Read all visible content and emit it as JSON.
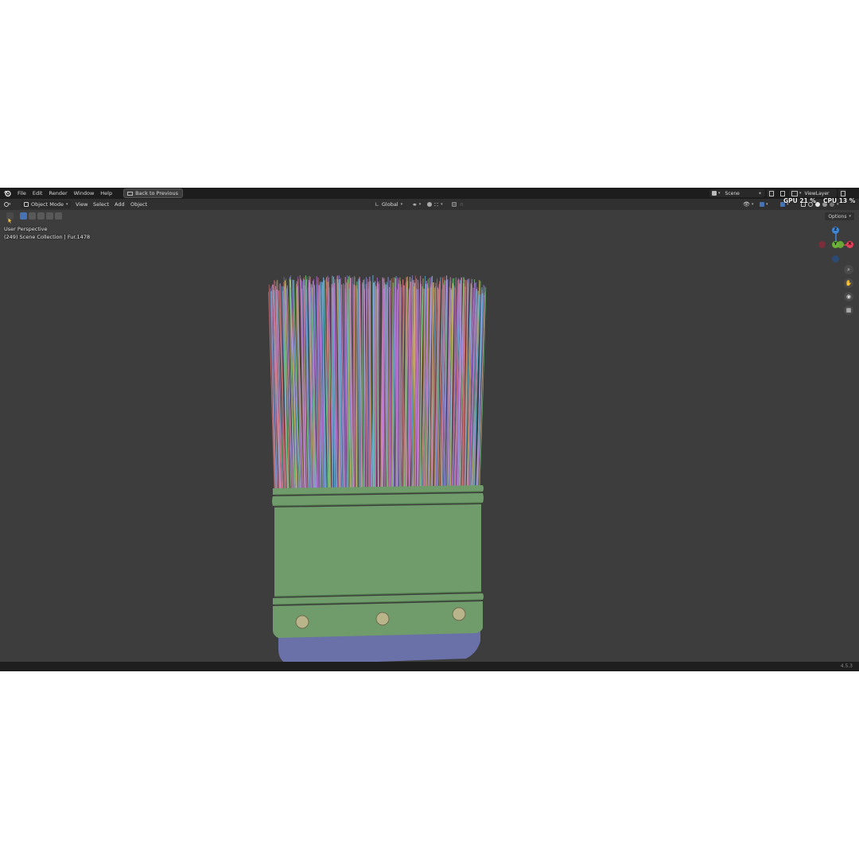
{
  "topbar": {
    "menus": [
      "File",
      "Edit",
      "Render",
      "Window",
      "Help"
    ],
    "back_button": "Back to Previous",
    "scene": "Scene",
    "view_layer": "ViewLayer"
  },
  "header": {
    "mode": "Object Mode",
    "menus": [
      "View",
      "Select",
      "Add",
      "Object"
    ],
    "transform_orientation": "Global"
  },
  "toolbar": {
    "options_label": "Options"
  },
  "viewport": {
    "perspective_label": "User Perspective",
    "collection_label": "(249) Scene Collection | Fur.1478",
    "gpu_stat": "GPU 21 %",
    "cpu_stat": "CPU 13 %",
    "gizmo_axes": {
      "z": "Z",
      "y": "Y",
      "x": "X"
    },
    "nav_icons": [
      "zoom-icon",
      "pan-hand-icon",
      "camera-icon",
      "grid-icon"
    ],
    "object": {
      "ferrule_color": "#6f9c6a",
      "handle_color": "#6a70a8",
      "rivet_color": "#b9b48a",
      "hair_colors": [
        "#b86bd8",
        "#5fb0d6",
        "#6fd07a",
        "#d07070",
        "#c9b35a",
        "#8a8ad8",
        "#d08ac0"
      ]
    }
  },
  "status": {
    "version": "4.5.3"
  },
  "colors": {
    "viewport_bg": "#3d3d3d",
    "topbar_bg": "#1d1d1d",
    "accent": "#4772b3",
    "axis_x": "#e0415a",
    "axis_y": "#6ab334",
    "axis_z": "#3f86d6"
  }
}
